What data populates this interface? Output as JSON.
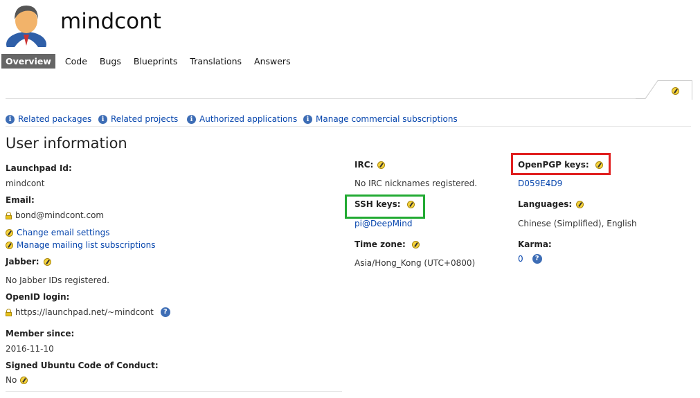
{
  "header": {
    "title": "mindcont"
  },
  "nav": {
    "overview": "Overview",
    "code": "Code",
    "bugs": "Bugs",
    "blueprints": "Blueprints",
    "translations": "Translations",
    "answers": "Answers"
  },
  "related": {
    "packages": "Related packages",
    "projects": "Related projects",
    "applications": "Authorized applications",
    "subscriptions": "Manage commercial subscriptions"
  },
  "user_info": {
    "heading": "User information",
    "launchpad_id_label": "Launchpad Id:",
    "launchpad_id": "mindcont",
    "email_label": "Email:",
    "email": "bond@mindcont.com",
    "change_email": "Change email settings",
    "manage_mailing": "Manage mailing list subscriptions",
    "jabber_label": "Jabber:",
    "jabber_value": "No Jabber IDs registered.",
    "openid_label": "OpenID login:",
    "openid_value": "https://launchpad.net/~mindcont",
    "member_since_label": "Member since:",
    "member_since": "2016-11-10",
    "coc_label": "Signed Ubuntu Code of Conduct:",
    "coc_value": "No"
  },
  "middle": {
    "irc_label": "IRC:",
    "irc_value": "No IRC nicknames registered.",
    "ssh_label": "SSH keys:",
    "ssh_value": "pi@DeepMind",
    "timezone_label": "Time zone:",
    "timezone_value": "Asia/Hong_Kong (UTC+0800)"
  },
  "right": {
    "pgp_label": "OpenPGP keys:",
    "pgp_value": "D059E4D9",
    "languages_label": "Languages:",
    "languages_value": "Chinese (Simplified), English",
    "karma_label": "Karma:",
    "karma_value": "0"
  },
  "icons": {
    "edit": "pencil-icon",
    "info": "info-icon",
    "help": "help-icon",
    "lock": "lock-icon",
    "avatar": "user-avatar"
  },
  "colors": {
    "link": "#0645ad",
    "highlight_red": "#e02020",
    "highlight_green": "#22aa33",
    "nav_active_bg": "#666666"
  }
}
